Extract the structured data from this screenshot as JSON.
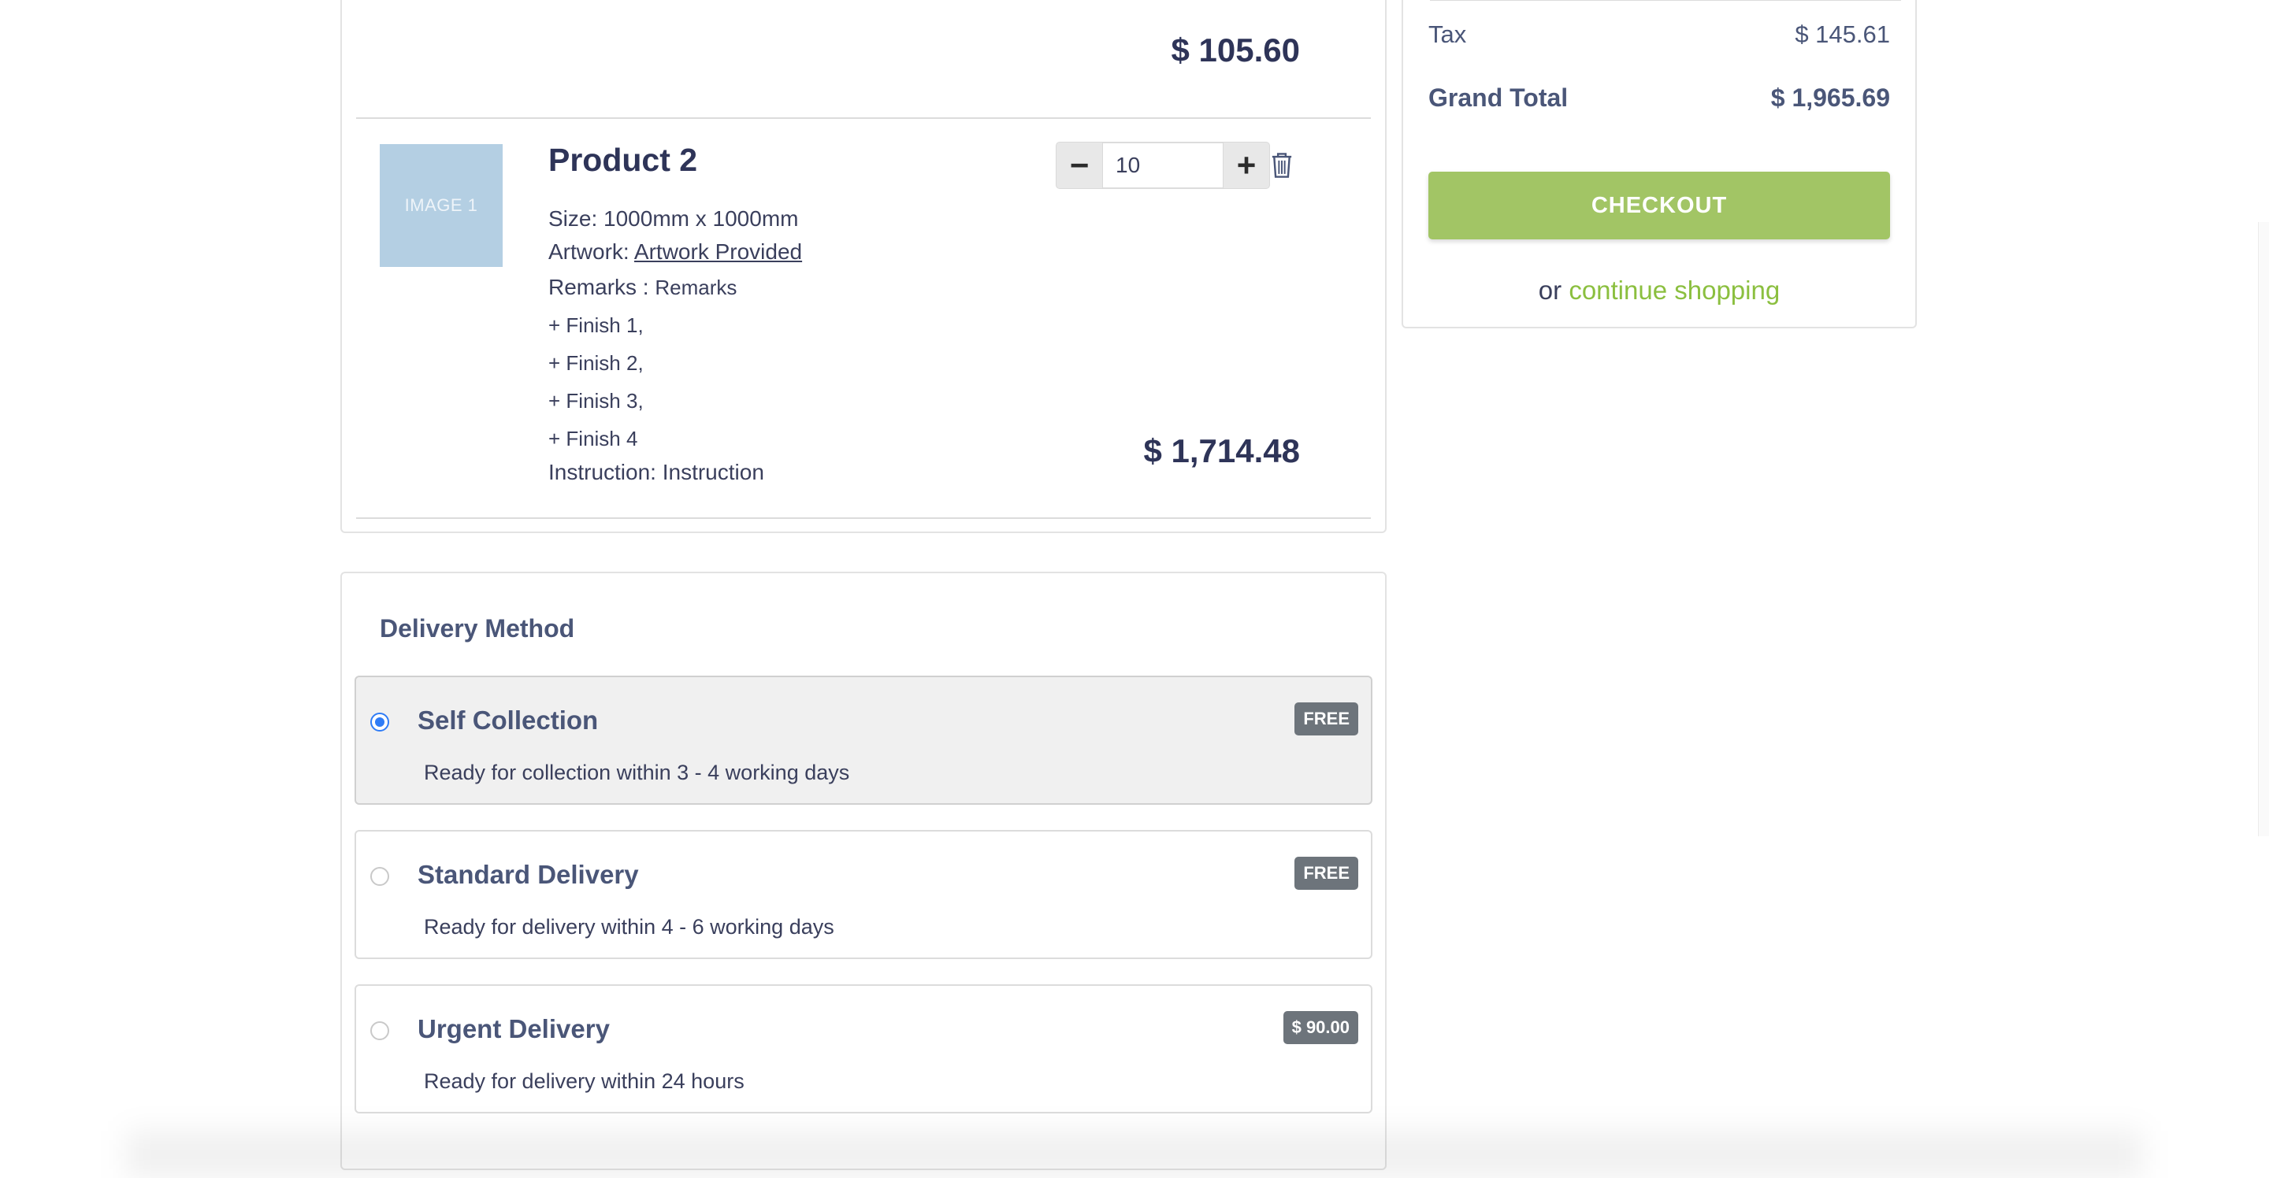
{
  "cart": {
    "previous_item_total": "$ 105.60",
    "item": {
      "image_label": "IMAGE 1",
      "title": "Product 2",
      "size": "Size: 1000mm x 1000mm",
      "artwork_label": "Artwork: ",
      "artwork_link": "Artwork Provided",
      "remarks_label": "Remarks : ",
      "remarks_value": "Remarks",
      "finishes": [
        "+ Finish 1,",
        "+ Finish 2,",
        "+ Finish 3,",
        "+ Finish 4"
      ],
      "instruction": "Instruction: Instruction",
      "quantity": "10",
      "line_total": "$ 1,714.48"
    }
  },
  "delivery": {
    "title": "Delivery Method",
    "options": [
      {
        "title": "Self Collection",
        "description": "Ready for collection within 3 - 4 working days",
        "price_badge": "FREE",
        "selected": true
      },
      {
        "title": "Standard Delivery",
        "description": "Ready for delivery within 4 - 6 working days",
        "price_badge": "FREE",
        "selected": false
      },
      {
        "title": "Urgent Delivery",
        "description": "Ready for delivery within 24 hours",
        "price_badge": "$ 90.00",
        "selected": false
      }
    ]
  },
  "summary": {
    "tax_label": "Tax",
    "tax_value": "$ 145.61",
    "grand_total_label": "Grand Total",
    "grand_total_value": "$ 1,965.69",
    "checkout_label": "CHECKOUT",
    "or_text": "or ",
    "continue_link": "continue shopping"
  },
  "colors": {
    "accent_green": "#a2c565",
    "link_green": "#8bbf3f",
    "radio_blue": "#2f7cf6",
    "badge_gray": "#6d747b",
    "text_navy": "#2e3458"
  }
}
